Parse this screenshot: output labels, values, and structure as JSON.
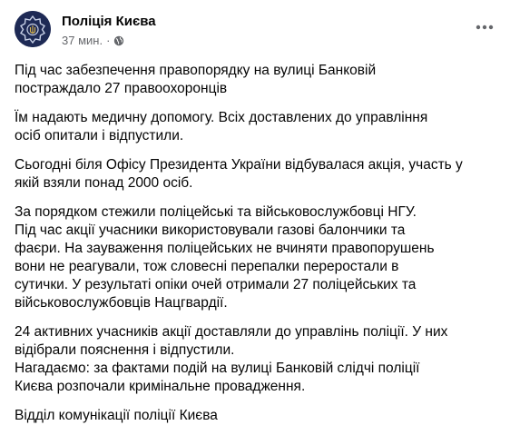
{
  "post": {
    "page_name": "Поліція Києва",
    "time": "37 мин.",
    "separator": "·",
    "avatar_text": "ПОЛІЦІЯ КИЄВА",
    "avatar_icon": "police-badge-icon",
    "audience_icon": "globe-icon",
    "more_icon": "more-options-icon"
  },
  "paragraphs": [
    {
      "lines": [
        "Під час забезпечення правопорядку на вулиці Банковій",
        "постраждало 27 правоохоронців"
      ]
    },
    {
      "lines": [
        "Їм надають медичну допомогу. Всіх доставлених до управління",
        "осіб опитали і відпустили."
      ]
    },
    {
      "lines": [
        "Сьогодні біля Офісу Президента України відбувалася акція, участь у",
        "якій взяли понад 2000 осіб."
      ]
    },
    {
      "lines": [
        "За порядком стежили поліцейські та військовослужбовці НГУ.",
        "Під час акції учасники використовували газові балончики та",
        "фаєри. На зауваження поліцейських не вчиняти правопорушень",
        "вони не реагували, тож  словесні перепалки переростали в",
        "сутички. У результаті опіки очей отримали 27 поліцейських та",
        "військовослужбовців Нацгвардії."
      ]
    },
    {
      "lines": [
        "24 активних учасників акції доставляли до управлінь поліції. У них",
        "відібрали пояснення і відпустили.",
        "Нагадаємо: за фактами подій на вулиці Банковій слідчі поліції",
        "Києва розпочали кримінальне провадження."
      ]
    },
    {
      "lines": [
        "Відділ комунікації поліції Києва"
      ]
    }
  ],
  "colors": {
    "text": "#050505",
    "secondary": "#65676b",
    "avatar_bg": "#1e2a55",
    "badge": "#c9d2e8"
  }
}
